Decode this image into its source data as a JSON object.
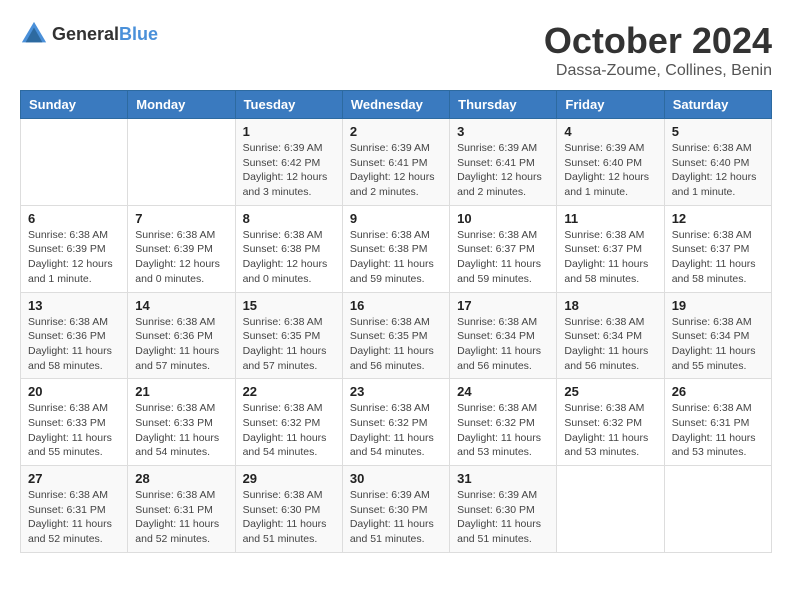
{
  "header": {
    "logo_general": "General",
    "logo_blue": "Blue",
    "title": "October 2024",
    "location": "Dassa-Zoume, Collines, Benin"
  },
  "weekdays": [
    "Sunday",
    "Monday",
    "Tuesday",
    "Wednesday",
    "Thursday",
    "Friday",
    "Saturday"
  ],
  "weeks": [
    [
      {
        "day": "",
        "info": ""
      },
      {
        "day": "",
        "info": ""
      },
      {
        "day": "1",
        "info": "Sunrise: 6:39 AM\nSunset: 6:42 PM\nDaylight: 12 hours and 3 minutes."
      },
      {
        "day": "2",
        "info": "Sunrise: 6:39 AM\nSunset: 6:41 PM\nDaylight: 12 hours and 2 minutes."
      },
      {
        "day": "3",
        "info": "Sunrise: 6:39 AM\nSunset: 6:41 PM\nDaylight: 12 hours and 2 minutes."
      },
      {
        "day": "4",
        "info": "Sunrise: 6:39 AM\nSunset: 6:40 PM\nDaylight: 12 hours and 1 minute."
      },
      {
        "day": "5",
        "info": "Sunrise: 6:38 AM\nSunset: 6:40 PM\nDaylight: 12 hours and 1 minute."
      }
    ],
    [
      {
        "day": "6",
        "info": "Sunrise: 6:38 AM\nSunset: 6:39 PM\nDaylight: 12 hours and 1 minute."
      },
      {
        "day": "7",
        "info": "Sunrise: 6:38 AM\nSunset: 6:39 PM\nDaylight: 12 hours and 0 minutes."
      },
      {
        "day": "8",
        "info": "Sunrise: 6:38 AM\nSunset: 6:38 PM\nDaylight: 12 hours and 0 minutes."
      },
      {
        "day": "9",
        "info": "Sunrise: 6:38 AM\nSunset: 6:38 PM\nDaylight: 11 hours and 59 minutes."
      },
      {
        "day": "10",
        "info": "Sunrise: 6:38 AM\nSunset: 6:37 PM\nDaylight: 11 hours and 59 minutes."
      },
      {
        "day": "11",
        "info": "Sunrise: 6:38 AM\nSunset: 6:37 PM\nDaylight: 11 hours and 58 minutes."
      },
      {
        "day": "12",
        "info": "Sunrise: 6:38 AM\nSunset: 6:37 PM\nDaylight: 11 hours and 58 minutes."
      }
    ],
    [
      {
        "day": "13",
        "info": "Sunrise: 6:38 AM\nSunset: 6:36 PM\nDaylight: 11 hours and 58 minutes."
      },
      {
        "day": "14",
        "info": "Sunrise: 6:38 AM\nSunset: 6:36 PM\nDaylight: 11 hours and 57 minutes."
      },
      {
        "day": "15",
        "info": "Sunrise: 6:38 AM\nSunset: 6:35 PM\nDaylight: 11 hours and 57 minutes."
      },
      {
        "day": "16",
        "info": "Sunrise: 6:38 AM\nSunset: 6:35 PM\nDaylight: 11 hours and 56 minutes."
      },
      {
        "day": "17",
        "info": "Sunrise: 6:38 AM\nSunset: 6:34 PM\nDaylight: 11 hours and 56 minutes."
      },
      {
        "day": "18",
        "info": "Sunrise: 6:38 AM\nSunset: 6:34 PM\nDaylight: 11 hours and 56 minutes."
      },
      {
        "day": "19",
        "info": "Sunrise: 6:38 AM\nSunset: 6:34 PM\nDaylight: 11 hours and 55 minutes."
      }
    ],
    [
      {
        "day": "20",
        "info": "Sunrise: 6:38 AM\nSunset: 6:33 PM\nDaylight: 11 hours and 55 minutes."
      },
      {
        "day": "21",
        "info": "Sunrise: 6:38 AM\nSunset: 6:33 PM\nDaylight: 11 hours and 54 minutes."
      },
      {
        "day": "22",
        "info": "Sunrise: 6:38 AM\nSunset: 6:32 PM\nDaylight: 11 hours and 54 minutes."
      },
      {
        "day": "23",
        "info": "Sunrise: 6:38 AM\nSunset: 6:32 PM\nDaylight: 11 hours and 54 minutes."
      },
      {
        "day": "24",
        "info": "Sunrise: 6:38 AM\nSunset: 6:32 PM\nDaylight: 11 hours and 53 minutes."
      },
      {
        "day": "25",
        "info": "Sunrise: 6:38 AM\nSunset: 6:32 PM\nDaylight: 11 hours and 53 minutes."
      },
      {
        "day": "26",
        "info": "Sunrise: 6:38 AM\nSunset: 6:31 PM\nDaylight: 11 hours and 53 minutes."
      }
    ],
    [
      {
        "day": "27",
        "info": "Sunrise: 6:38 AM\nSunset: 6:31 PM\nDaylight: 11 hours and 52 minutes."
      },
      {
        "day": "28",
        "info": "Sunrise: 6:38 AM\nSunset: 6:31 PM\nDaylight: 11 hours and 52 minutes."
      },
      {
        "day": "29",
        "info": "Sunrise: 6:38 AM\nSunset: 6:30 PM\nDaylight: 11 hours and 51 minutes."
      },
      {
        "day": "30",
        "info": "Sunrise: 6:39 AM\nSunset: 6:30 PM\nDaylight: 11 hours and 51 minutes."
      },
      {
        "day": "31",
        "info": "Sunrise: 6:39 AM\nSunset: 6:30 PM\nDaylight: 11 hours and 51 minutes."
      },
      {
        "day": "",
        "info": ""
      },
      {
        "day": "",
        "info": ""
      }
    ]
  ]
}
